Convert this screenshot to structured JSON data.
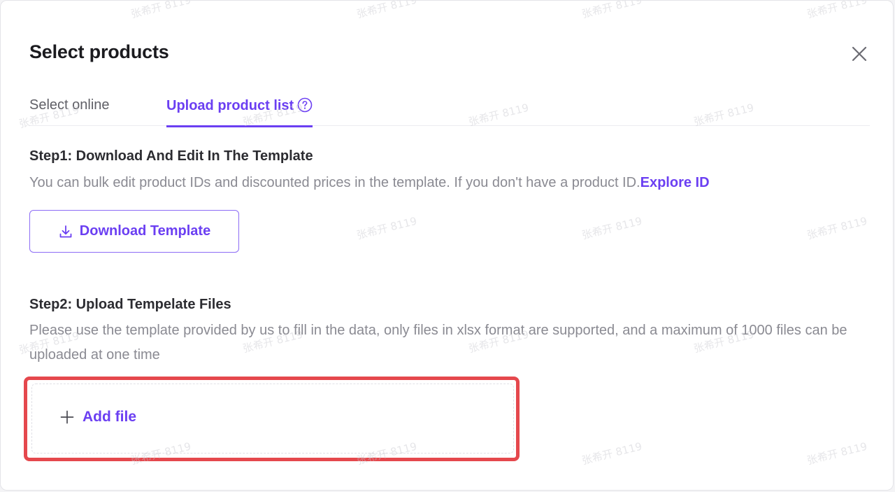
{
  "dialog": {
    "title": "Select products",
    "close_icon": "close-icon"
  },
  "tabs": [
    {
      "label": "Select online",
      "active": false
    },
    {
      "label": "Upload product list",
      "active": true,
      "icon": "help-circle-icon"
    }
  ],
  "step1": {
    "title": "Step1:  Download And Edit In The Template",
    "description": "You can bulk edit product IDs and discounted prices in the template. If you don't have a product ID.",
    "link_label": "Explore ID",
    "button_label": "Download Template",
    "button_icon": "download-icon"
  },
  "step2": {
    "title": "Step2:  Upload Tempelate Files",
    "description": "Please use the template provided by us to fill in the data, only files in xlsx format are supported, and a maximum of 1000 files can be uploaded at one time",
    "add_label": "Add file",
    "add_icon": "plus-icon"
  },
  "watermark": {
    "text": "张希开 8119",
    "color": "#c9c9cf"
  },
  "colors": {
    "accent": "#6b3ff2",
    "highlight": "#e5484d"
  }
}
